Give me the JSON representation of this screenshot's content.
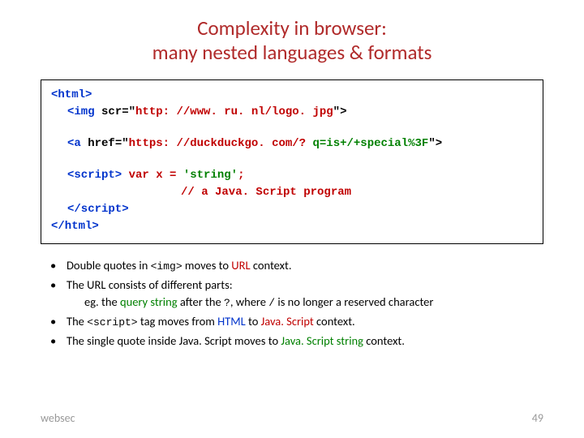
{
  "title_line1": "Complexity in browser:",
  "title_line2": "many nested languages & formats",
  "code": {
    "l1a": "<html>",
    "l2a": "<img ",
    "l2b": "scr=\"",
    "l2c": "http: //www. ru. nl/logo. jpg",
    "l2d": "\">",
    "l3a": "<a ",
    "l3b": "href=\"",
    "l3c": "https: //duckduckgo. com/? ",
    "l3d": "q=is+/+special%3F",
    "l3e": "\">",
    "l4a": "<script>",
    "l4b": " var x = ",
    "l4c": "'string'",
    "l4d": ";",
    "l5": "// a Java. Script program",
    "l6": "</script>",
    "l7": "</html>"
  },
  "b1a": "Double quotes in ",
  "b1b": "<img>",
  "b1c": " moves to ",
  "b1d": "URL",
  "b1e": " context.",
  "b2": "The URL consists of different parts:",
  "b2sub_a": "eg. the ",
  "b2sub_b": "query string",
  "b2sub_c": " after the ",
  "b2sub_d": "?",
  "b2sub_e": ", where ",
  "b2sub_f": "/",
  "b2sub_g": " is no longer a reserved character",
  "b3a": "The ",
  "b3b": "<script>",
  "b3c": " tag moves from ",
  "b3d": "HTML",
  "b3e": " to ",
  "b3f": "Java. Script",
  "b3g": " context.",
  "b4a": "The single quote inside Java. Script moves to ",
  "b4b": "Java. Script string",
  "b4c": " context.",
  "footer_left": "websec",
  "footer_right": "49"
}
